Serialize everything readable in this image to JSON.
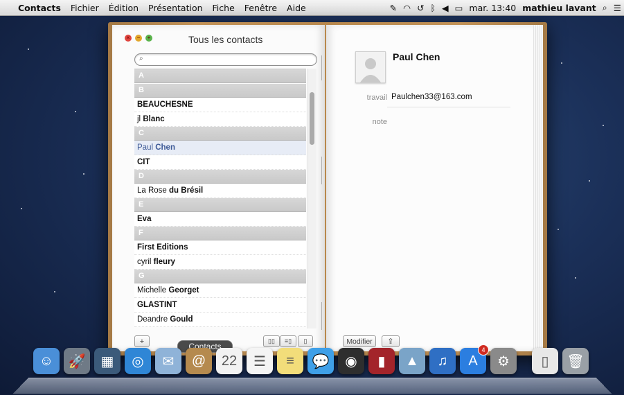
{
  "menubar": {
    "apple": "",
    "items": [
      "Contacts",
      "Fichier",
      "Édition",
      "Présentation",
      "Fiche",
      "Fenêtre",
      "Aide"
    ],
    "clock": "mar. 13:40",
    "user": "mathieu lavant"
  },
  "window": {
    "title": "Tous les contacts"
  },
  "search": {
    "placeholder": ""
  },
  "contacts": {
    "sections": [
      {
        "letter": "A",
        "rows": []
      },
      {
        "letter": "B",
        "rows": [
          {
            "first": "",
            "last": "BEAUCHESNE"
          },
          {
            "first": "jl",
            "last": "Blanc"
          }
        ]
      },
      {
        "letter": "C",
        "rows": [
          {
            "first": "Paul",
            "last": "Chen",
            "selected": true
          },
          {
            "first": "",
            "last": "CIT"
          }
        ]
      },
      {
        "letter": "D",
        "rows": [
          {
            "first": "La Rose",
            "last": "du Brésil"
          }
        ]
      },
      {
        "letter": "E",
        "rows": [
          {
            "first": "",
            "last": "Eva"
          }
        ]
      },
      {
        "letter": "F",
        "rows": [
          {
            "first": "",
            "last": "First Editions"
          },
          {
            "first": "cyril",
            "last": "fleury"
          }
        ]
      },
      {
        "letter": "G",
        "rows": [
          {
            "first": "Michelle",
            "last": "Georget"
          },
          {
            "first": "",
            "last": "GLASTINT"
          },
          {
            "first": "Deandre",
            "last": "Gould"
          }
        ]
      }
    ]
  },
  "card": {
    "name": "Paul Chen",
    "work_label": "travail",
    "work_email": "Paulchen33@163.com",
    "note_label": "note",
    "edit_button": "Modifier"
  },
  "bottom": {
    "add_label": "+",
    "tooltip": "Contacts"
  },
  "dock": {
    "items": [
      {
        "name": "finder-icon",
        "color": "#4a8fd8",
        "glyph": "☺"
      },
      {
        "name": "launchpad-icon",
        "color": "#6f7a86",
        "glyph": "🚀"
      },
      {
        "name": "mission-control-icon",
        "color": "#3b5a7a",
        "glyph": "▦"
      },
      {
        "name": "safari-icon",
        "color": "#2f86d6",
        "glyph": "◎"
      },
      {
        "name": "mail-icon",
        "color": "#8fb3d8",
        "glyph": "✉"
      },
      {
        "name": "contacts-icon",
        "color": "#b58a4e",
        "glyph": "@"
      },
      {
        "name": "calendar-icon",
        "color": "#f2f2f2",
        "glyph": "22"
      },
      {
        "name": "reminders-icon",
        "color": "#f4f4f4",
        "glyph": "☰"
      },
      {
        "name": "notes-icon",
        "color": "#f2dd7a",
        "glyph": "≡"
      },
      {
        "name": "messages-icon",
        "color": "#3fa0e8",
        "glyph": "💬"
      },
      {
        "name": "facetime-icon",
        "color": "#2e2e2e",
        "glyph": "◉"
      },
      {
        "name": "photo-booth-icon",
        "color": "#a3242a",
        "glyph": "▮"
      },
      {
        "name": "iphoto-icon",
        "color": "#7aa4c8",
        "glyph": "▲"
      },
      {
        "name": "itunes-icon",
        "color": "#2f6fc4",
        "glyph": "♫"
      },
      {
        "name": "app-store-icon",
        "color": "#2b7ee0",
        "glyph": "A",
        "badge": "4"
      },
      {
        "name": "system-preferences-icon",
        "color": "#8a8a8a",
        "glyph": "⚙"
      },
      {
        "name": "documents-icon",
        "color": "#e8e8e8",
        "glyph": "▯"
      },
      {
        "name": "trash-icon",
        "color": "#9aa0a6",
        "glyph": "🗑"
      }
    ]
  }
}
